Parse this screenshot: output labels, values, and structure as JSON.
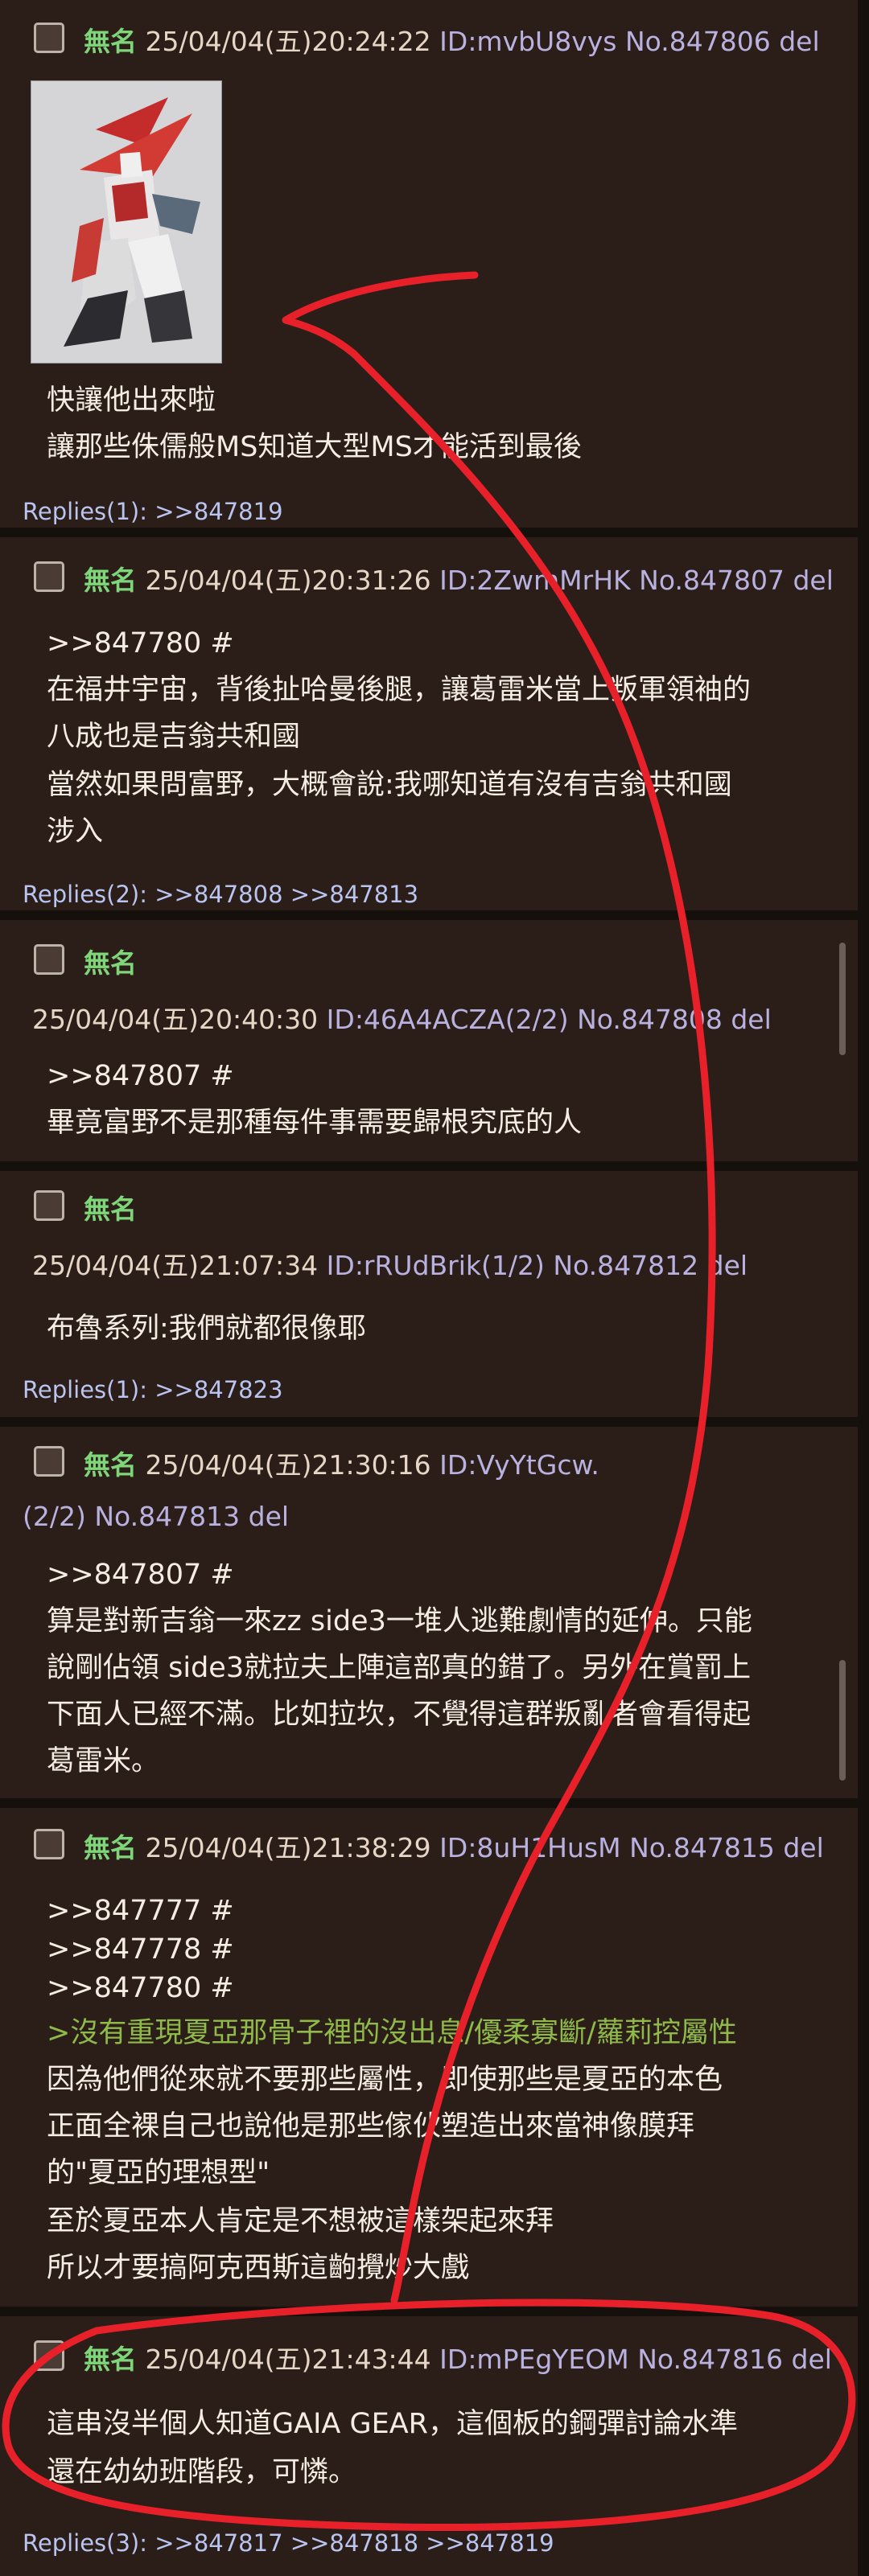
{
  "posts": [
    {
      "name": "無名",
      "datetime": "25/04/04(五)20:24:22",
      "id": "ID:mvbU8vys",
      "no": "No.847806",
      "del": "del",
      "has_image": true,
      "body": [
        "快讓他出來啦",
        "讓那些侏儒般MS知道大型MS才能活到最後"
      ],
      "replies_label": "Replies(1):",
      "replies": [
        ">>847819"
      ]
    },
    {
      "name": "無名",
      "datetime": "25/04/04(五)20:31:26",
      "id": "ID:2ZwmMrHK",
      "no": "No.847807",
      "del": "del",
      "ref": ">>847780 #",
      "body": [
        "在福井宇宙，背後扯哈曼後腿，讓葛雷米當上叛軍領袖的",
        "八成也是吉翁共和國",
        "當然如果問富野，大概會說:我哪知道有沒有吉翁共和國",
        "涉入"
      ],
      "replies_label": "Replies(2):",
      "replies": [
        ">>847808",
        ">>847813"
      ]
    },
    {
      "name": "無名",
      "datetime": "25/04/04(五)20:40:30",
      "id": "ID:46A4ACZA(2/2)",
      "no": "No.847808",
      "del": "del",
      "ref": ">>847807 #",
      "body": [
        "畢竟富野不是那種每件事需要歸根究底的人"
      ]
    },
    {
      "name": "無名",
      "datetime": "25/04/04(五)21:07:34",
      "id": "ID:rRUdBrik(1/2)",
      "no": "No.847812",
      "del": "del",
      "body": [
        "布魯系列:我們就都很像耶"
      ],
      "replies_label": "Replies(1):",
      "replies": [
        ">>847823"
      ]
    },
    {
      "name": "無名",
      "datetime": "25/04/04(五)21:30:16",
      "id": "ID:VyYtGcw.",
      "id_suffix": "(2/2)",
      "no": "No.847813",
      "del": "del",
      "ref": ">>847807 #",
      "body": [
        "算是對新吉翁一來zz side3一堆人逃難劇情的延伸。只能",
        "說剛佔領 side3就拉夫上陣這部真的錯了。另外在賞罰上",
        "下面人已經不滿。比如拉坎，不覺得這群叛亂者會看得起",
        "葛雷米。"
      ]
    },
    {
      "name": "無名",
      "datetime": "25/04/04(五)21:38:29",
      "id": "ID:8uH1HusM",
      "no": "No.847815",
      "del": "del",
      "refs": [
        ">>847777 #",
        ">>847778 #",
        ">>847780 #"
      ],
      "quote": ">沒有重現夏亞那骨子裡的沒出息/優柔寡斷/蘿莉控屬性",
      "body": [
        "因為他們從來就不要那些屬性，即使那些是夏亞的本色",
        "正面全裸自己也說他是那些傢伙塑造出來當神像膜拜",
        "的\"夏亞的理想型\"",
        "至於夏亞本人肯定是不想被這樣架起來拜",
        "所以才要搞阿克西斯這齣攪炒大戲"
      ]
    },
    {
      "name": "無名",
      "datetime": "25/04/04(五)21:43:44",
      "id": "ID:mPEgYEOM",
      "no": "No.847816",
      "del": "del",
      "body": [
        "這串沒半個人知道GAIA GEAR，這個板的鋼彈討論水準",
        "還在幼幼班階段，可憐。"
      ],
      "replies_label": "Replies(3):",
      "replies": [
        ">>847817",
        ">>847818",
        ">>847819"
      ]
    }
  ],
  "colors": {
    "annotation": "#e8202a",
    "name": "#7fd67a",
    "id": "#b9b2e0",
    "quote": "#8fba4a"
  }
}
